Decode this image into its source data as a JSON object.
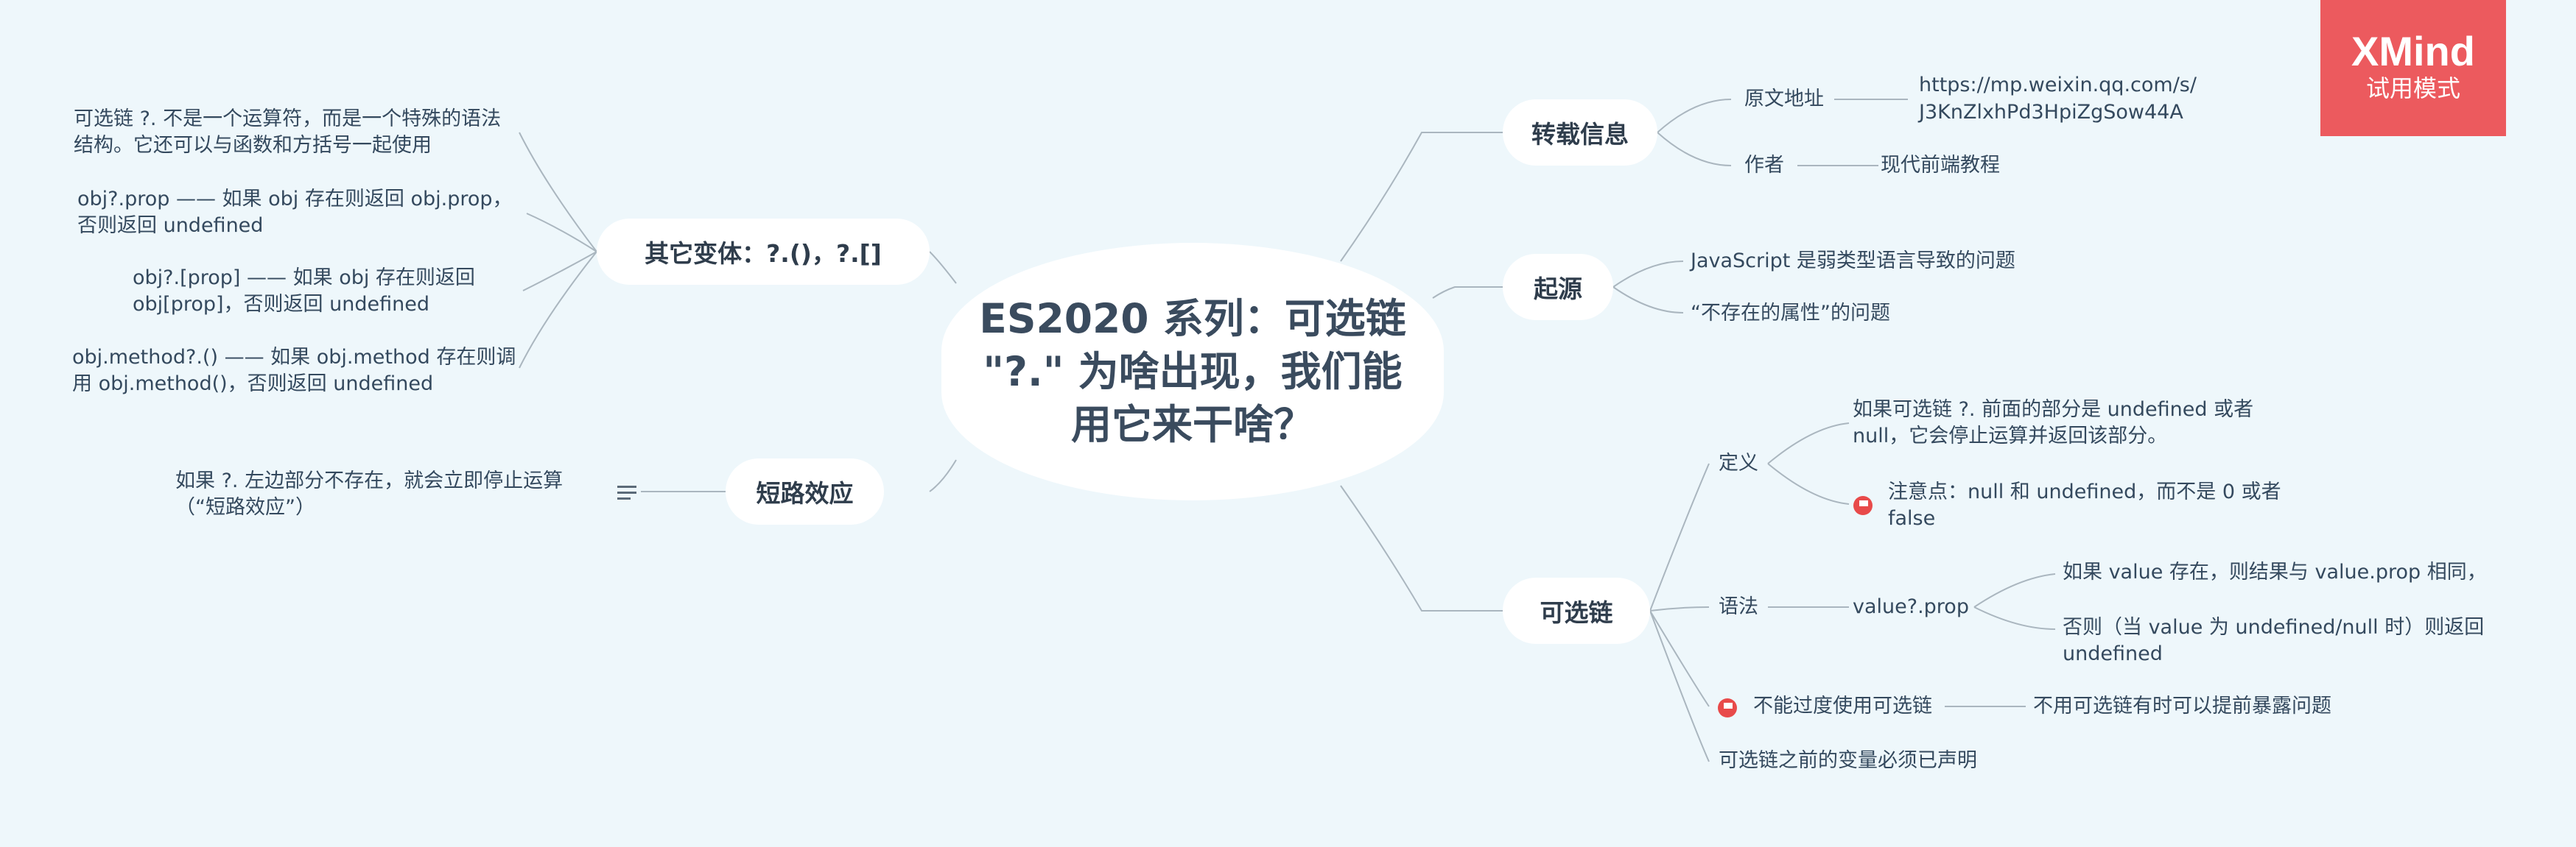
{
  "central": "ES2020 系列：可选链 \"?.\" 为啥出现，我们能用它来干啥？",
  "watermark": {
    "brand": "XMind",
    "mode": "试用模式"
  },
  "colors": {
    "background": "#eef7fb",
    "line": "#aab6bf",
    "flag": "#e84a4a",
    "watermark": "#ec5a5e"
  },
  "topics": {
    "repost": {
      "label": "转载信息",
      "source_label": "原文地址",
      "source_url_1": "https://mp.weixin.qq.com/s/",
      "source_url_2": "J3KnZlxhPd3HpiZgSow44A",
      "author_label": "作者",
      "author_value": "现代前端教程"
    },
    "origin": {
      "label": "起源",
      "items": [
        "JavaScript 是弱类型语言导致的问题",
        "“不存在的属性”的问题"
      ]
    },
    "optional": {
      "label": "可选链",
      "definition": {
        "label": "定义",
        "text": "如果可选链 ?. 前面的部分是 undefined 或者 null，它会停止运算并返回该部分。",
        "note": "注意点：null  和 undefined，而不是 0 或者 false"
      },
      "syntax": {
        "label": "语法",
        "expr": "value?.prop",
        "case1": "如果 value 存在，则结果与 value.prop 相同，",
        "case2": "否则（当 value 为 undefined/null 时）则返回 undefined"
      },
      "overuse": {
        "label": "不能过度使用可选链",
        "detail": "不用可选链有时可以提前暴露问题"
      },
      "declared": "可选链之前的变量必须已声明"
    },
    "variants": {
      "label": "其它变体：?.()，?.[]",
      "items": [
        "可选链 ?. 不是一个运算符，而是一个特殊的语法结构。它还可以与函数和方括号一起使用",
        "obj?.prop —— 如果 obj 存在则返回 obj.prop，否则返回 undefined",
        "obj?.[prop] —— 如果 obj 存在则返回 obj[prop]，否则返回 undefined",
        "obj.method?.() —— 如果 obj.method 存在则调用 obj.method()，否则返回 undefined"
      ]
    },
    "short": {
      "label": "短路效应",
      "text": "如果 ?. 左边部分不存在，就会立即停止运算（“短路效应”）"
    }
  }
}
